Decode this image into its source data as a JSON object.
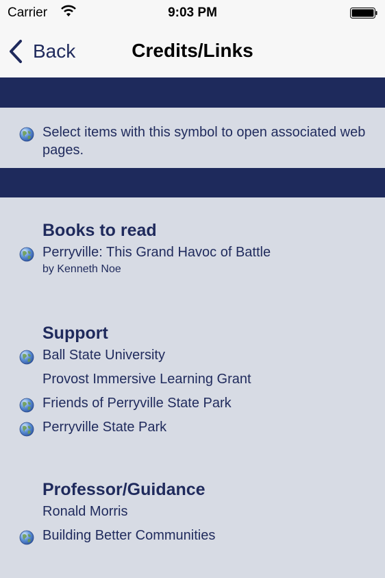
{
  "status": {
    "carrier": "Carrier",
    "time": "9:03 PM"
  },
  "nav": {
    "back_label": "Back",
    "title": "Credits/Links"
  },
  "info": {
    "text": "Select items with this symbol to open associated web pages."
  },
  "sections": {
    "books": {
      "heading": "Books to read",
      "item_title": "Perryville: This Grand Havoc of Battle",
      "item_author": "by Kenneth Noe"
    },
    "support": {
      "heading": "Support",
      "items": [
        "Ball State University",
        "Provost Immersive Learning Grant",
        "Friends of Perryville State Park",
        "Perryville State Park"
      ]
    },
    "professor": {
      "heading": "Professor/Guidance",
      "items": [
        "Ronald Morris",
        "Building Better Communities"
      ]
    }
  },
  "colors": {
    "navy": "#1e2a5c",
    "background": "#d7dbe4",
    "nav_background": "#f7f7f7"
  }
}
